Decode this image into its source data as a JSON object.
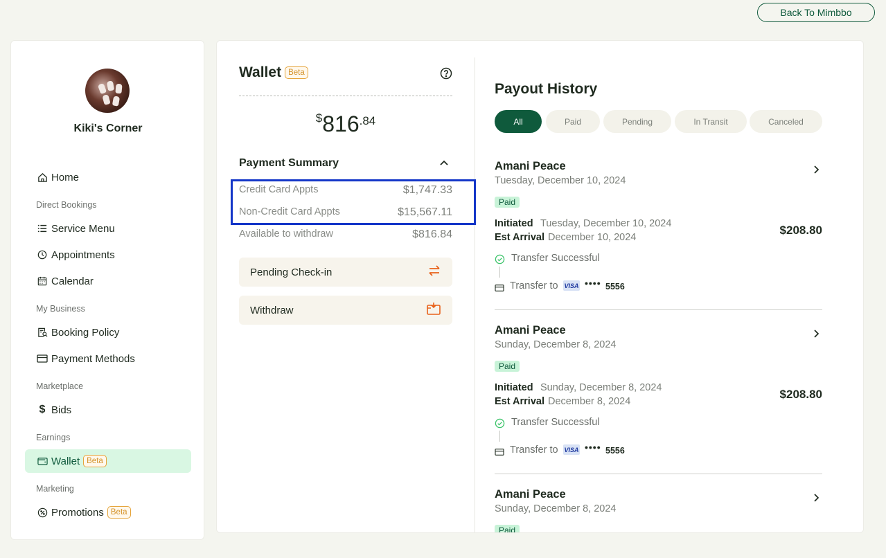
{
  "header": {
    "back_label": "Back To Mimbbo"
  },
  "sidebar": {
    "business_name": "Kiki's Corner",
    "items": {
      "home": "Home",
      "section_direct": "Direct Bookings",
      "service_menu": "Service Menu",
      "appointments": "Appointments",
      "calendar": "Calendar",
      "section_business": "My Business",
      "booking_policy": "Booking Policy",
      "payment_methods": "Payment Methods",
      "section_marketplace": "Marketplace",
      "bids": "Bids",
      "section_earnings": "Earnings",
      "wallet": "Wallet",
      "wallet_badge": "Beta",
      "section_marketing": "Marketing",
      "promotions": "Promotions",
      "promotions_badge": "Beta"
    }
  },
  "wallet": {
    "title": "Wallet",
    "badge": "Beta",
    "balance_currency": "$",
    "balance_dollars": "816",
    "balance_cents": ".84",
    "summary_title": "Payment Summary",
    "credit_label": "Credit Card Appts",
    "credit_value": "$1,747.33",
    "noncredit_label": "Non-Credit Card Appts",
    "noncredit_value": "$15,567.11",
    "available_label": "Available to withdraw",
    "available_value": "$816.84",
    "pending_label": "Pending Check-in",
    "withdraw_label": "Withdraw"
  },
  "payouts": {
    "title": "Payout History",
    "filters": [
      "All",
      "Paid",
      "Pending",
      "In Transit",
      "Canceled"
    ],
    "items": [
      {
        "name": "Amani Peace",
        "date": "Tuesday, December 10, 2024",
        "status": "Paid",
        "initiated_label": "Initiated",
        "initiated": "Tuesday, December 10, 2024",
        "arrival_label": "Est Arrival",
        "arrival": "December 10, 2024",
        "amount": "$208.80",
        "transfer_status": "Transfer Successful",
        "transfer_to": "Transfer to",
        "card_brand": "VISA",
        "card_dots": "••••",
        "card_last4": "5556"
      },
      {
        "name": "Amani Peace",
        "date": "Sunday, December 8, 2024",
        "status": "Paid",
        "initiated_label": "Initiated",
        "initiated": "Sunday, December 8, 2024",
        "arrival_label": "Est Arrival",
        "arrival": "December 8, 2024",
        "amount": "$208.80",
        "transfer_status": "Transfer Successful",
        "transfer_to": "Transfer to",
        "card_brand": "VISA",
        "card_dots": "••••",
        "card_last4": "5556"
      },
      {
        "name": "Amani Peace",
        "date": "Sunday, December 8, 2024",
        "status": "Paid"
      }
    ]
  }
}
